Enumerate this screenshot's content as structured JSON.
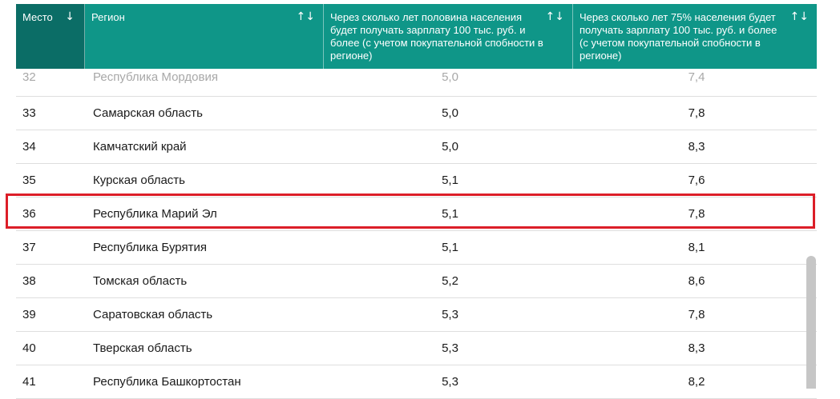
{
  "table": {
    "headers": [
      {
        "label": "Место",
        "sort_icon": "↓"
      },
      {
        "label": "Регион",
        "sort_icon": "↑↓"
      },
      {
        "label": "Через сколько лет половина населения будет получать зарплату 100 тыс. руб. и более (с учетом покупательной спобности в регионе)",
        "sort_icon": "↑↓"
      },
      {
        "label": "Через сколько лет 75% населения будет получать зарплату 100 тыс. руб. и более (с учетом покупательной спобности в регионе)",
        "sort_icon": "↑↓"
      }
    ],
    "rows": [
      {
        "rank": "32",
        "region": "Республика Мордовия",
        "half": "5,0",
        "pct75": "7,4"
      },
      {
        "rank": "33",
        "region": "Самарская область",
        "half": "5,0",
        "pct75": "7,8"
      },
      {
        "rank": "34",
        "region": "Камчатский край",
        "half": "5,0",
        "pct75": "8,3"
      },
      {
        "rank": "35",
        "region": "Курская область",
        "half": "5,1",
        "pct75": "7,6"
      },
      {
        "rank": "36",
        "region": "Республика Марий Эл",
        "half": "5,1",
        "pct75": "7,8"
      },
      {
        "rank": "37",
        "region": "Республика Бурятия",
        "half": "5,1",
        "pct75": "8,1"
      },
      {
        "rank": "38",
        "region": "Томская область",
        "half": "5,2",
        "pct75": "8,6"
      },
      {
        "rank": "39",
        "region": "Саратовская область",
        "half": "5,3",
        "pct75": "7,8"
      },
      {
        "rank": "40",
        "region": "Тверская область",
        "half": "5,3",
        "pct75": "8,3"
      },
      {
        "rank": "41",
        "region": "Республика Башкортостан",
        "half": "5,3",
        "pct75": "8,2"
      }
    ]
  },
  "colors": {
    "header_bg": "#0f9688",
    "header_active_bg": "#0b6d66",
    "highlight_border": "#dc1e28"
  }
}
